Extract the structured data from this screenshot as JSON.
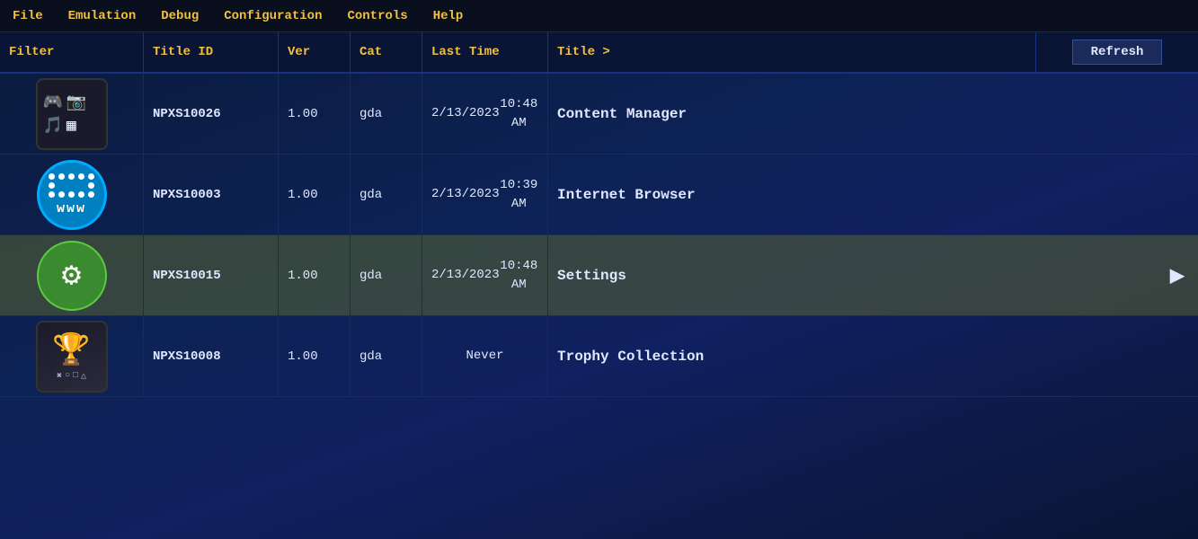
{
  "menubar": {
    "items": [
      {
        "id": "file",
        "label": "File"
      },
      {
        "id": "emulation",
        "label": "Emulation"
      },
      {
        "id": "debug",
        "label": "Debug"
      },
      {
        "id": "configuration",
        "label": "Configuration"
      },
      {
        "id": "controls",
        "label": "Controls"
      },
      {
        "id": "help",
        "label": "Help"
      }
    ]
  },
  "table": {
    "headers": {
      "filter": "Filter",
      "titleid": "Title ID",
      "ver": "Ver",
      "cat": "Cat",
      "lasttime": "Last Time",
      "title": "Title >",
      "refresh": "Refresh"
    },
    "rows": [
      {
        "id": "npxs10026",
        "titleid": "NPXS10026",
        "ver": "1.00",
        "cat": "gda",
        "lasttime_line1": "2/13/2023",
        "lasttime_line2": "10:48 AM",
        "title": "Content Manager",
        "selected": false
      },
      {
        "id": "npxs10003",
        "titleid": "NPXS10003",
        "ver": "1.00",
        "cat": "gda",
        "lasttime_line1": "2/13/2023",
        "lasttime_line2": "10:39 AM",
        "title": "Internet Browser",
        "selected": false
      },
      {
        "id": "npxs10015",
        "titleid": "NPXS10015",
        "ver": "1.00",
        "cat": "gda",
        "lasttime_line1": "2/13/2023",
        "lasttime_line2": "10:48 AM",
        "title": "Settings",
        "selected": true
      },
      {
        "id": "npxs10008",
        "titleid": "NPXS10008",
        "ver": "1.00",
        "cat": "gda",
        "lasttime_line1": "Never",
        "lasttime_line2": "",
        "title": "Trophy Collection",
        "selected": false
      }
    ]
  }
}
